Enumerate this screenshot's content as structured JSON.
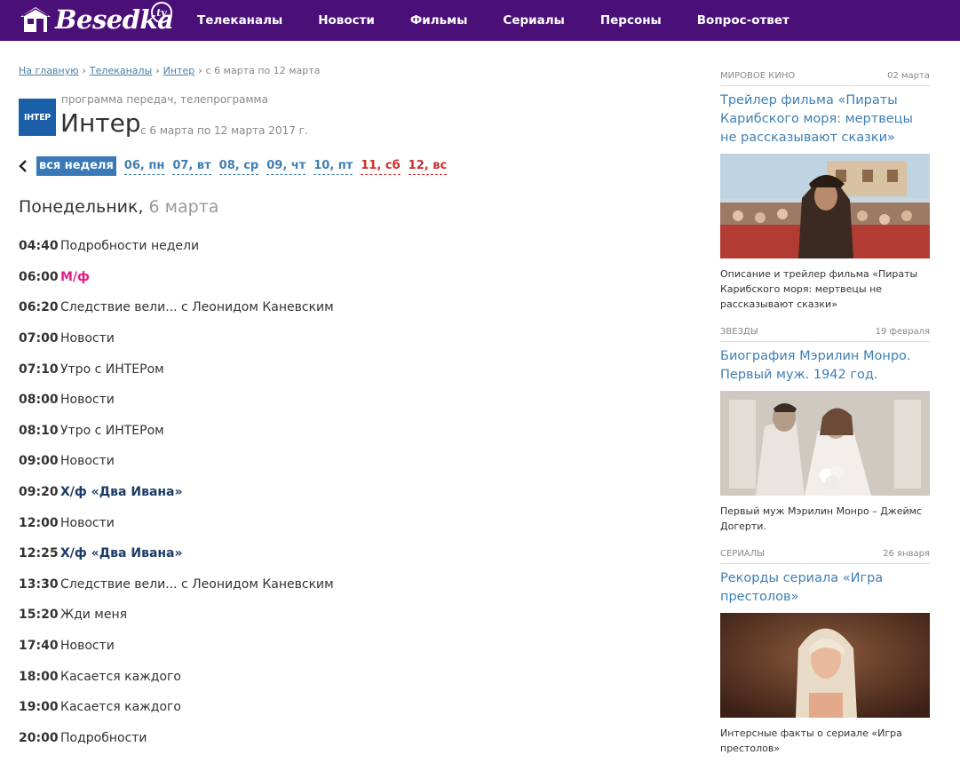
{
  "header": {
    "logo_text": "Besedka",
    "logo_badge": "tv",
    "nav": [
      "Телеканалы",
      "Новости",
      "Фильмы",
      "Сериалы",
      "Персоны",
      "Вопрос-ответ"
    ]
  },
  "breadcrumb": {
    "home": "На главную",
    "channels": "Телеканалы",
    "channel": "Интер",
    "current": "с 6 марта по 12 марта"
  },
  "channel": {
    "logo_text": "ІНТЕР",
    "subtitle": "программа передач, телепрограмма",
    "name": "Интер",
    "dates": "с 6 марта по 12 марта 2017 г."
  },
  "day_tabs": [
    "вся неделя",
    "06, пн",
    "07, вт",
    "08, ср",
    "09, чт",
    "10, пт",
    "11, сб",
    "12, вс"
  ],
  "day_heading": {
    "weekday": "Понедельник,",
    "date": "6 марта"
  },
  "schedule": [
    {
      "time": "04:40",
      "title": "Подробности недели",
      "kind": "normal"
    },
    {
      "time": "06:00",
      "title": "М/ф",
      "kind": "cartoon"
    },
    {
      "time": "06:20",
      "title": "Следствие вели... с Леонидом Каневским",
      "kind": "normal"
    },
    {
      "time": "07:00",
      "title": "Новости",
      "kind": "normal"
    },
    {
      "time": "07:10",
      "title": "Утро с ИНТЕРом",
      "kind": "normal"
    },
    {
      "time": "08:00",
      "title": "Новости",
      "kind": "normal"
    },
    {
      "time": "08:10",
      "title": "Утро с ИНТЕРом",
      "kind": "normal"
    },
    {
      "time": "09:00",
      "title": "Новости",
      "kind": "normal"
    },
    {
      "time": "09:20",
      "title": "Х/ф «Два Ивана»",
      "kind": "movie"
    },
    {
      "time": "12:00",
      "title": "Новости",
      "kind": "normal"
    },
    {
      "time": "12:25",
      "title": "Х/ф «Два Ивана»",
      "kind": "movie"
    },
    {
      "time": "13:30",
      "title": "Следствие вели... с Леонидом Каневским",
      "kind": "normal"
    },
    {
      "time": "15:20",
      "title": "Жди меня",
      "kind": "normal"
    },
    {
      "time": "17:40",
      "title": "Новости",
      "kind": "normal"
    },
    {
      "time": "18:00",
      "title": "Касается каждого",
      "kind": "normal"
    },
    {
      "time": "19:00",
      "title": "Касается каждого",
      "kind": "normal"
    },
    {
      "time": "20:00",
      "title": "Подробности",
      "kind": "normal"
    }
  ],
  "sidebar": [
    {
      "category": "МИРОВОЕ КИНО",
      "date": "02 марта",
      "title": "Трейлер фильма «Пираты Карибского моря: мертвецы не рассказывают сказки»",
      "caption": "Описание и трейлер фильма «Пираты Карибского моря: мертвецы не рассказывают сказки»"
    },
    {
      "category": "ЗВЕЗДЫ",
      "date": "19 февраля",
      "title": "Биография Мэрилин Монро. Первый муж. 1942 год.",
      "caption": "Первый муж Мэрилин Монро – Джеймс Догерти."
    },
    {
      "category": "СЕРИАЛЫ",
      "date": "26 января",
      "title": "Рекорды сериала «Игра престолов»",
      "caption": "Интерсные факты о сериале «Игра престолов»"
    }
  ],
  "colors": {
    "header_bg": "#4b0f78",
    "link": "#3f7fb4",
    "cartoon": "#e01f8c",
    "movie": "#1b3c66",
    "weekend": "#d22c2c"
  }
}
